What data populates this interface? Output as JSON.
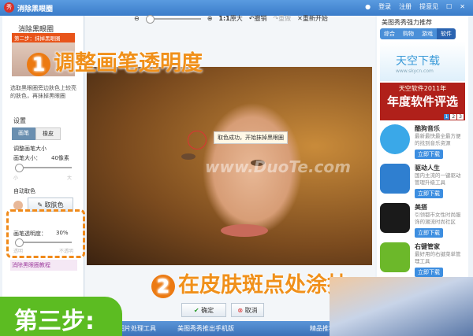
{
  "window": {
    "title": "消除黑眼圈",
    "login": "登录",
    "register": "注册",
    "feedback": "提意见"
  },
  "left": {
    "heading": "消除黑眼圈",
    "step_banner": "第二步：抹掉黑眼圈",
    "hint": "选取黑眼圈旁边肤色上较亮的肤色，再抹掉黑眼圈",
    "settings": "设置",
    "tab_brush": "画笔",
    "tab_eraser": "橡皮",
    "size_section": "调整画笔大小",
    "size_label": "画笔大小：",
    "size_value": "40像素",
    "size_min": "小",
    "size_max": "大",
    "color_section": "自动取色",
    "pick_color": "取肤色",
    "opacity_label": "画笔透明度：",
    "opacity_value": "30%",
    "opacity_min": "透明",
    "opacity_max": "不透明",
    "tutorial": "消除黑眼圈教程"
  },
  "toolbar": {
    "actual": "1:1",
    "original": "原大",
    "undo": "撤销",
    "redo": "重做",
    "restart": "重新开始"
  },
  "canvas": {
    "tooltip": "取色成功，开始抹掉黑眼圈",
    "watermark": "www.DuoTe.com"
  },
  "annotations": {
    "step1_num": "1",
    "step1": "调整画笔透明度",
    "step2_num": "2",
    "step2": "在皮肤斑点处涂抹",
    "step3": "第三步:"
  },
  "buttons": {
    "ok": "确定",
    "cancel": "取消"
  },
  "right": {
    "title": "美图秀秀强力推荐",
    "tabs": [
      "综合",
      "购物",
      "游戏",
      "软件"
    ],
    "ad1": "天空下载",
    "ad1_url": "www.skycn.com",
    "ad2_top": "天空软件2011年",
    "ad2": "年度软件评选",
    "pages": [
      "1",
      "2",
      "3"
    ],
    "apps": [
      {
        "name": "酷狗音乐",
        "desc": "最新最快最全最方便的找到音乐资源",
        "dl": "立即下载",
        "color": "#3aa8e8"
      },
      {
        "name": "驱动人生",
        "desc": "国内主流的一键驱动管理升级工具",
        "dl": "立即下载",
        "color": "#2f7fd0"
      },
      {
        "name": "美搭",
        "desc": "引领都市女性时尚服饰的潮流时尚社区",
        "dl": "立即下载",
        "color": "#1a1a1a"
      },
      {
        "name": "右键管家",
        "desc": "最好用的右键菜单管理工具",
        "dl": "立即下载",
        "color": "#6cb82a"
      }
    ]
  },
  "bottom": {
    "items": [
      "图片处理工具",
      "美图秀秀推出手机版",
      "精品推荐"
    ]
  }
}
